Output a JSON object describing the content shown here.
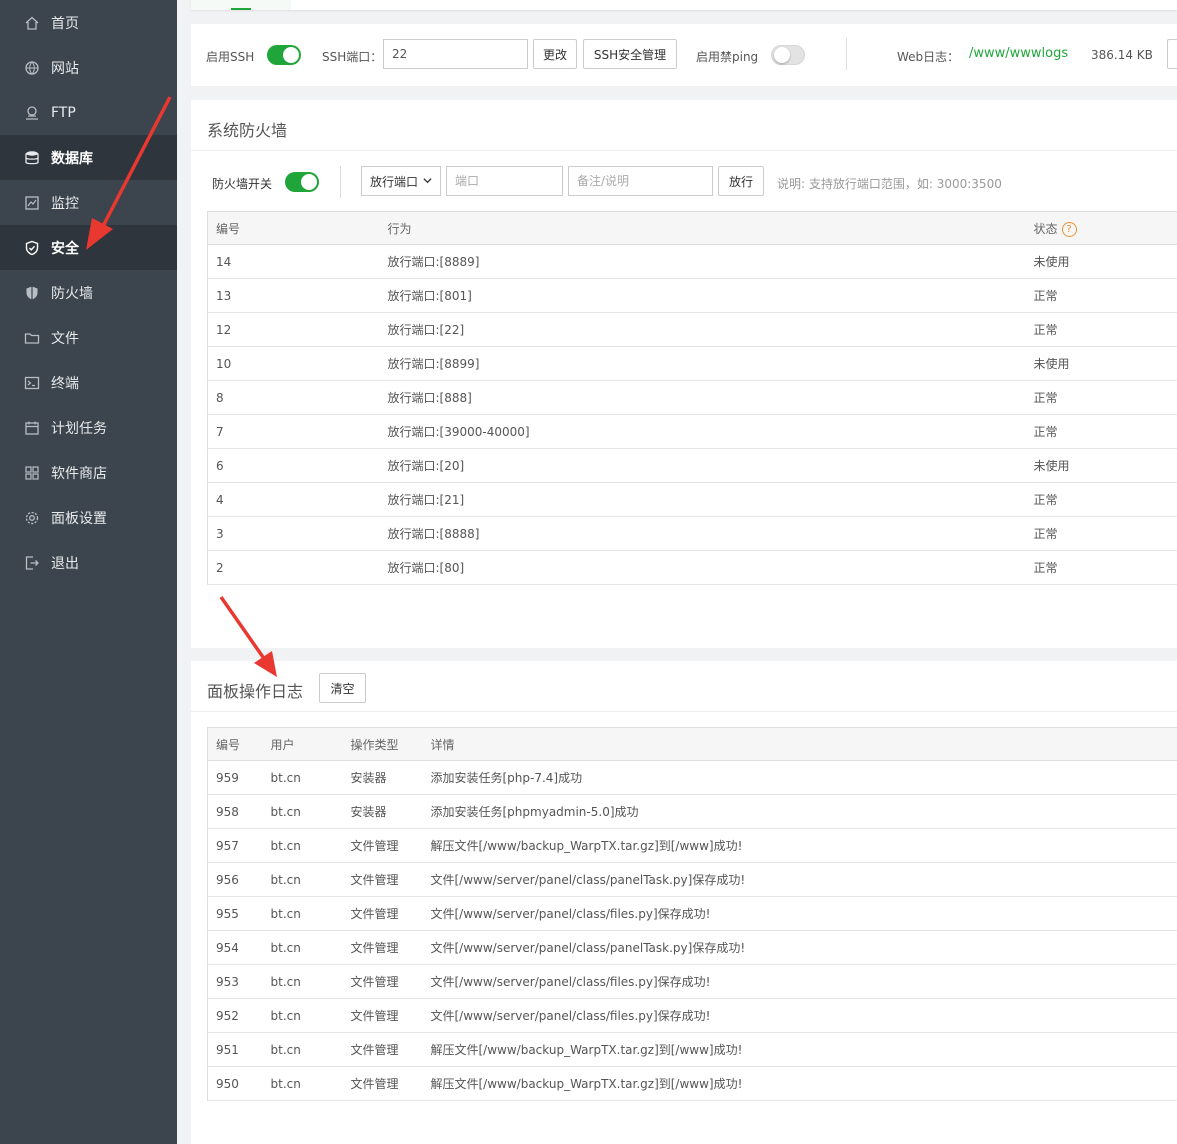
{
  "sidebar": {
    "items": [
      {
        "label": "首页",
        "icon": "home-icon"
      },
      {
        "label": "网站",
        "icon": "globe-icon"
      },
      {
        "label": "FTP",
        "icon": "ftp-icon"
      },
      {
        "label": "数据库",
        "icon": "database-icon"
      },
      {
        "label": "监控",
        "icon": "monitor-icon"
      },
      {
        "label": "安全",
        "icon": "shield-icon"
      },
      {
        "label": "防火墙",
        "icon": "firewall-icon"
      },
      {
        "label": "文件",
        "icon": "folder-icon"
      },
      {
        "label": "终端",
        "icon": "terminal-icon"
      },
      {
        "label": "计划任务",
        "icon": "calendar-icon"
      },
      {
        "label": "软件商店",
        "icon": "grid-icon"
      },
      {
        "label": "面板设置",
        "icon": "gear-icon"
      },
      {
        "label": "退出",
        "icon": "logout-icon"
      }
    ]
  },
  "ssh": {
    "enable_label": "启用SSH",
    "port_label": "SSH端口：",
    "port_value": "22",
    "change_btn": "更改",
    "manage_btn": "SSH安全管理",
    "ping_label": "启用禁ping",
    "weblog_label": "Web日志：",
    "weblog_path": "/www/wwwlogs",
    "weblog_size": "386.14 KB"
  },
  "firewall": {
    "title": "系统防火墙",
    "switch_label": "防火墙开关",
    "select_value": "放行端口",
    "port_placeholder": "端口",
    "note_placeholder": "备注/说明",
    "allow_btn": "放行",
    "hint": "说明: 支持放行端口范围，如: 3000:3500",
    "columns": [
      "编号",
      "行为",
      "状态"
    ],
    "rows": [
      {
        "id": "14",
        "action": "放行端口:[8889]",
        "status": "未使用"
      },
      {
        "id": "13",
        "action": "放行端口:[801]",
        "status": "正常"
      },
      {
        "id": "12",
        "action": "放行端口:[22]",
        "status": "正常"
      },
      {
        "id": "10",
        "action": "放行端口:[8899]",
        "status": "未使用"
      },
      {
        "id": "8",
        "action": "放行端口:[888]",
        "status": "正常"
      },
      {
        "id": "7",
        "action": "放行端口:[39000-40000]",
        "status": "正常"
      },
      {
        "id": "6",
        "action": "放行端口:[20]",
        "status": "未使用"
      },
      {
        "id": "4",
        "action": "放行端口:[21]",
        "status": "正常"
      },
      {
        "id": "3",
        "action": "放行端口:[8888]",
        "status": "正常"
      },
      {
        "id": "2",
        "action": "放行端口:[80]",
        "status": "正常"
      }
    ]
  },
  "oplog": {
    "title": "面板操作日志",
    "clear_btn": "清空",
    "columns": [
      "编号",
      "用户",
      "操作类型",
      "详情"
    ],
    "rows": [
      {
        "id": "959",
        "user": "bt.cn",
        "type": "安装器",
        "detail": "添加安装任务[php-7.4]成功"
      },
      {
        "id": "958",
        "user": "bt.cn",
        "type": "安装器",
        "detail": "添加安装任务[phpmyadmin-5.0]成功"
      },
      {
        "id": "957",
        "user": "bt.cn",
        "type": "文件管理",
        "detail": "解压文件[/www/backup_WarpTX.tar.gz]到[/www]成功!"
      },
      {
        "id": "956",
        "user": "bt.cn",
        "type": "文件管理",
        "detail": "文件[/www/server/panel/class/panelTask.py]保存成功!"
      },
      {
        "id": "955",
        "user": "bt.cn",
        "type": "文件管理",
        "detail": "文件[/www/server/panel/class/files.py]保存成功!"
      },
      {
        "id": "954",
        "user": "bt.cn",
        "type": "文件管理",
        "detail": "文件[/www/server/panel/class/panelTask.py]保存成功!"
      },
      {
        "id": "953",
        "user": "bt.cn",
        "type": "文件管理",
        "detail": "文件[/www/server/panel/class/files.py]保存成功!"
      },
      {
        "id": "952",
        "user": "bt.cn",
        "type": "文件管理",
        "detail": "文件[/www/server/panel/class/files.py]保存成功!"
      },
      {
        "id": "951",
        "user": "bt.cn",
        "type": "文件管理",
        "detail": "解压文件[/www/backup_WarpTX.tar.gz]到[/www]成功!"
      },
      {
        "id": "950",
        "user": "bt.cn",
        "type": "文件管理",
        "detail": "解压文件[/www/backup_WarpTX.tar.gz]到[/www]成功!"
      }
    ]
  },
  "colors": {
    "sidebar_bg": "#3c444d",
    "accent_green": "#20a53a",
    "annotation_red": "#e8382f"
  }
}
